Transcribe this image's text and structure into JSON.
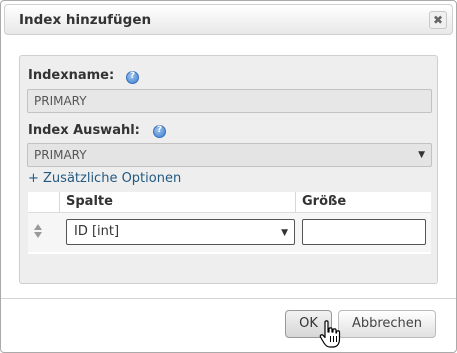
{
  "dialog": {
    "title": "Index hinzufügen",
    "close_glyph": "✖"
  },
  "form": {
    "indexname_label": "Indexname:",
    "indexname_value": "PRIMARY",
    "index_choice_label": "Index Auswahl:",
    "index_choice_value": "PRIMARY",
    "more_options_link": "+ Zusätzliche Optionen"
  },
  "table": {
    "headers": [
      "Spalte",
      "Größe"
    ],
    "rows": [
      {
        "column": "ID [int]",
        "size": ""
      }
    ]
  },
  "buttons": {
    "ok": "OK",
    "cancel": "Abbrechen"
  },
  "icons": {
    "help": "help-icon",
    "close": "close-icon",
    "drag": "drag-handle-icon",
    "cursor": "hand-cursor-icon"
  },
  "colors": {
    "link": "#235a81",
    "help_icon": "#3f7fcf"
  }
}
